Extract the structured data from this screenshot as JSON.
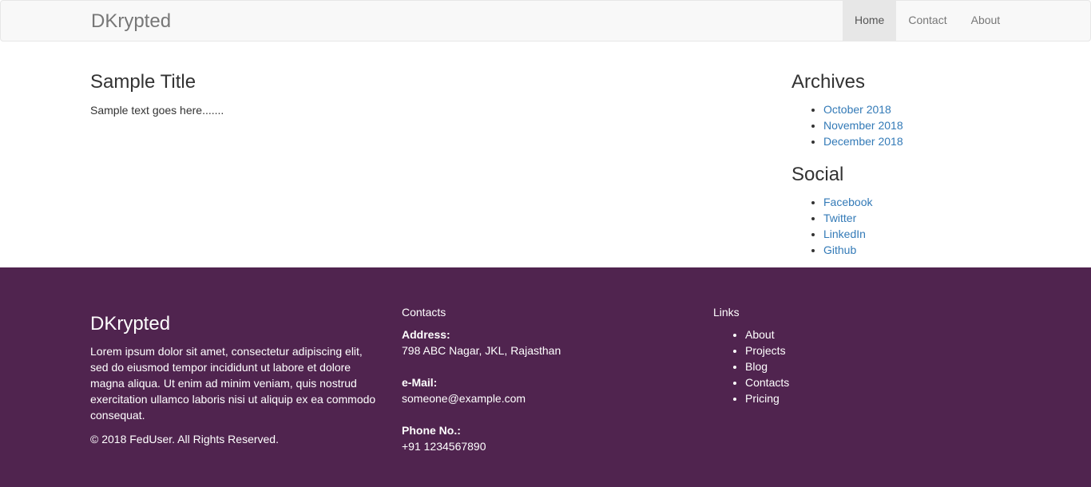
{
  "navbar": {
    "brand": "DKrypted",
    "items": [
      {
        "label": "Home",
        "active": true
      },
      {
        "label": "Contact",
        "active": false
      },
      {
        "label": "About",
        "active": false
      }
    ]
  },
  "main": {
    "title": "Sample Title",
    "text": "Sample text goes here......."
  },
  "sidebar": {
    "archives_title": "Archives",
    "archives": [
      "October 2018",
      "November 2018",
      "December 2018"
    ],
    "social_title": "Social",
    "social": [
      "Facebook",
      "Twitter",
      "LinkedIn",
      "Github"
    ]
  },
  "footer": {
    "brand": "DKrypted",
    "description": "Lorem ipsum dolor sit amet, consectetur adipiscing elit, sed do eiusmod tempor incididunt ut labore et dolore magna aliqua. Ut enim ad minim veniam, quis nostrud exercitation ullamco laboris nisi ut aliquip ex ea commodo consequat.",
    "copyright": "© 2018 FedUser. All Rights Reserved.",
    "contacts_title": "Contacts",
    "address_label": "Address:",
    "address": "798 ABC Nagar, JKL, Rajasthan",
    "email_label": "e-Mail:",
    "email": "someone@example.com",
    "phone_label": "Phone No.:",
    "phone": "+91 1234567890",
    "links_title": "Links",
    "links": [
      "About",
      "Projects",
      "Blog",
      "Contacts",
      "Pricing"
    ]
  },
  "colors": {
    "footer_bg": "#50244f",
    "link": "#337ab7",
    "navbar_bg": "#f8f8f8"
  }
}
